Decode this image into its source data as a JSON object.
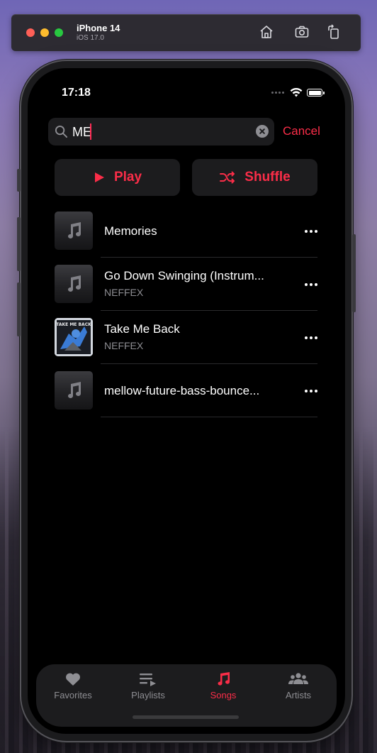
{
  "simulator": {
    "device": "iPhone 14",
    "os": "iOS 17.0",
    "toolbar_icons": [
      "home-icon",
      "screenshot-icon",
      "rotate-icon"
    ]
  },
  "status_bar": {
    "time": "17:18"
  },
  "search": {
    "query": "ME",
    "cancel_label": "Cancel"
  },
  "actions": {
    "play_label": "Play",
    "shuffle_label": "Shuffle"
  },
  "songs": [
    {
      "title": "Memories",
      "artist": "",
      "artwork": "music-note-placeholder"
    },
    {
      "title": "Go Down Swinging (Instrum...",
      "artist": "NEFFEX",
      "artwork": "music-note-placeholder"
    },
    {
      "title": "Take Me Back",
      "artist": "NEFFEX",
      "artwork": "album-cover"
    },
    {
      "title": "mellow-future-bass-bounce...",
      "artist": "",
      "artwork": "music-note-placeholder"
    }
  ],
  "cover_text": "TAKE ME BACK",
  "tabs": [
    {
      "label": "Favorites",
      "icon": "heart-icon",
      "active": false
    },
    {
      "label": "Playlists",
      "icon": "playlist-icon",
      "active": false
    },
    {
      "label": "Songs",
      "icon": "music-note-icon",
      "active": true
    },
    {
      "label": "Artists",
      "icon": "people-icon",
      "active": false
    }
  ],
  "colors": {
    "accent": "#fa2d48",
    "background": "#000000",
    "surface": "#1c1c1e",
    "secondary_text": "#8e8e93"
  }
}
